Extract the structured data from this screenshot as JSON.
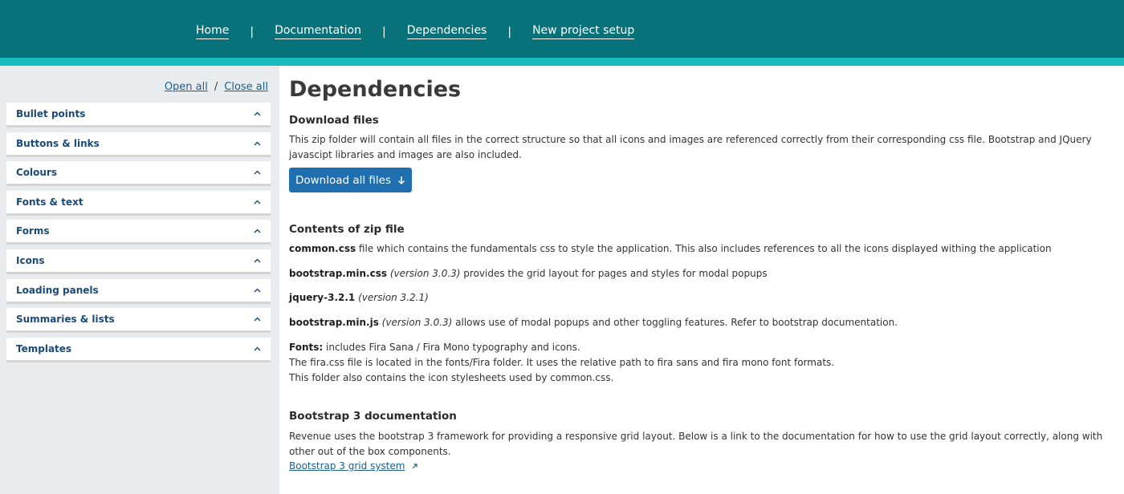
{
  "nav": {
    "home": "Home",
    "documentation": "Documentation",
    "dependencies": "Dependencies",
    "new_project_setup": "New project setup",
    "separator": "|"
  },
  "sidebar": {
    "open_all": "Open all",
    "close_all": "Close all",
    "toggle_separator": "/",
    "items": [
      {
        "label": "Bullet points"
      },
      {
        "label": "Buttons & links"
      },
      {
        "label": "Colours"
      },
      {
        "label": "Fonts & text"
      },
      {
        "label": "Forms"
      },
      {
        "label": "Icons"
      },
      {
        "label": "Loading panels"
      },
      {
        "label": "Summaries & lists"
      },
      {
        "label": "Templates"
      }
    ]
  },
  "main": {
    "title": "Dependencies",
    "download": {
      "heading": "Download files",
      "text": "This zip folder will contain all files in the correct structure so that all icons and images are referenced correctly from their corresponding css file. Bootstrap and JQuery javascipt libraries and images are also included.",
      "button": "Download all files"
    },
    "contents": {
      "heading": "Contents of zip file",
      "items": [
        {
          "name": "common.css",
          "version": "",
          "text": " file which contains the fundamentals css to style the application. This also includes references to all the icons displayed withing the application"
        },
        {
          "name": "bootstrap.min.css",
          "version": "(version 3.0.3)",
          "text": " provides the grid layout for pages and styles for modal popups"
        },
        {
          "name": "jquery-3.2.1",
          "version": "(version 3.2.1)",
          "text": ""
        },
        {
          "name": "bootstrap.min.js",
          "version": "(version 3.0.3)",
          "text": " allows use of modal popups and other toggling features. Refer to bootstrap documentation."
        }
      ],
      "fonts": {
        "label": "Fonts:",
        "line1": " includes Fira Sana / Fira Mono typography and icons.",
        "line2": "The fira.css file is located in the fonts/Fira folder. It uses the relative path to fira sans and fira mono font formats.",
        "line3": "This folder also contains the icon stylesheets used by common.css."
      }
    },
    "bootstrap": {
      "heading": "Bootstrap 3 documentation",
      "text": "Revenue uses the bootstrap 3 framework for providing a responsive grid layout. Below is a link to the documentation for how to use the grid layout correctly, along with other out of the box components.",
      "link": "Bootstrap 3 grid system"
    }
  },
  "colors": {
    "header": "#08727b",
    "header_accent": "#19bcbc",
    "sidebar_bg": "#e9ecef",
    "primary_button": "#1f6fb0",
    "link": "#1a5f8f"
  },
  "icons": {
    "accordion": "chevron-up-icon",
    "download": "arrow-down-icon",
    "external": "external-link-icon"
  }
}
